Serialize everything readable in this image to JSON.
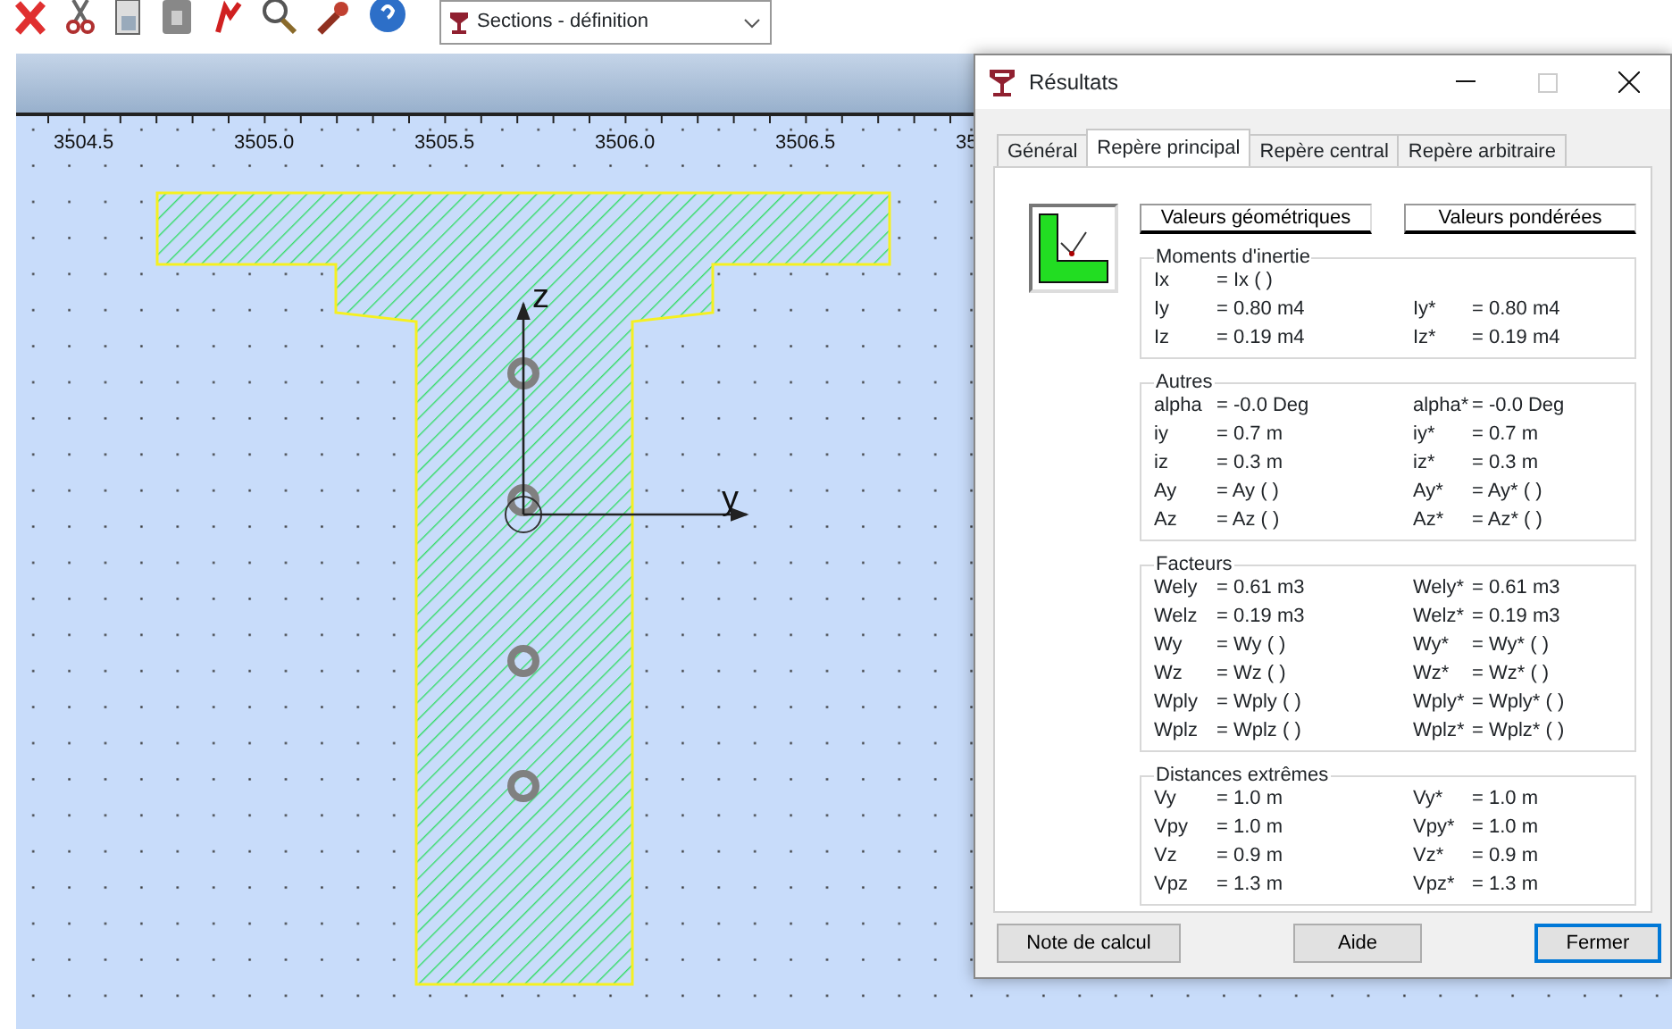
{
  "toolbar": {
    "section_dropdown": "Sections - définition"
  },
  "ruler": {
    "labels": [
      "3504.5",
      "3505.0",
      "3505.5",
      "3506.0",
      "3506.5",
      "35"
    ]
  },
  "canvas": {
    "axis_labels": [
      "z",
      "y"
    ]
  },
  "dialog": {
    "title": "Résultats",
    "tabs": [
      {
        "label": "Général",
        "selected": false
      },
      {
        "label": "Repère principal",
        "selected": true
      },
      {
        "label": "Repère central",
        "selected": false
      },
      {
        "label": "Repère arbitraire",
        "selected": false
      }
    ],
    "value_tabs": [
      "Valeurs géométriques",
      "Valeurs pondérées"
    ],
    "groups": [
      {
        "title": "Moments d'inertie",
        "rows": [
          {
            "label": "Ix",
            "value": "= Ix ( )"
          },
          {
            "label": "Iy",
            "value": "= 0.80 m4",
            "label2": "Iy*",
            "value2": "= 0.80 m4"
          },
          {
            "label": "Iz",
            "value": "= 0.19 m4",
            "label2": "Iz*",
            "value2": "= 0.19 m4"
          }
        ]
      },
      {
        "title": "Autres",
        "rows": [
          {
            "label": "alpha",
            "value": "= -0.0 Deg",
            "label2": "alpha*",
            "value2": "= -0.0 Deg"
          },
          {
            "label": "iy",
            "value": "= 0.7 m",
            "label2": "iy*",
            "value2": "= 0.7 m"
          },
          {
            "label": "iz",
            "value": "= 0.3 m",
            "label2": "iz*",
            "value2": "= 0.3 m"
          },
          {
            "label": "Ay",
            "value": "= Ay ( )",
            "label2": "Ay*",
            "value2": "= Ay* ( )"
          },
          {
            "label": "Az",
            "value": "= Az ( )",
            "label2": "Az*",
            "value2": "= Az* ( )"
          }
        ]
      },
      {
        "title": "Facteurs",
        "rows": [
          {
            "label": "Wely",
            "value": "= 0.61 m3",
            "label2": "Wely*",
            "value2": "= 0.61 m3"
          },
          {
            "label": "Welz",
            "value": "= 0.19 m3",
            "label2": "Welz*",
            "value2": "= 0.19 m3"
          },
          {
            "label": "Wy",
            "value": "= Wy ( )",
            "label2": "Wy*",
            "value2": "= Wy* ( )"
          },
          {
            "label": "Wz",
            "value": "= Wz ( )",
            "label2": "Wz*",
            "value2": "= Wz* ( )"
          },
          {
            "label": "Wply",
            "value": "= Wply ( )",
            "label2": "Wply*",
            "value2": "= Wply* ( )"
          },
          {
            "label": "Wplz",
            "value": "= Wplz ( )",
            "label2": "Wplz*",
            "value2": "= Wplz* ( )"
          }
        ]
      },
      {
        "title": "Distances extrêmes",
        "rows": [
          {
            "label": "Vy",
            "value": "= 1.0 m",
            "label2": "Vy*",
            "value2": "= 1.0 m"
          },
          {
            "label": "Vpy",
            "value": "= 1.0 m",
            "label2": "Vpy*",
            "value2": "= 1.0 m"
          },
          {
            "label": "Vz",
            "value": "= 0.9 m",
            "label2": "Vz*",
            "value2": "= 0.9 m"
          },
          {
            "label": "Vpz",
            "value": "= 1.3 m",
            "label2": "Vpz*",
            "value2": "= 1.3 m"
          }
        ]
      }
    ],
    "buttons": [
      {
        "label": "Note de calcul",
        "default": false
      },
      {
        "label": "Aide",
        "default": false
      },
      {
        "label": "Fermer",
        "default": true
      }
    ]
  }
}
